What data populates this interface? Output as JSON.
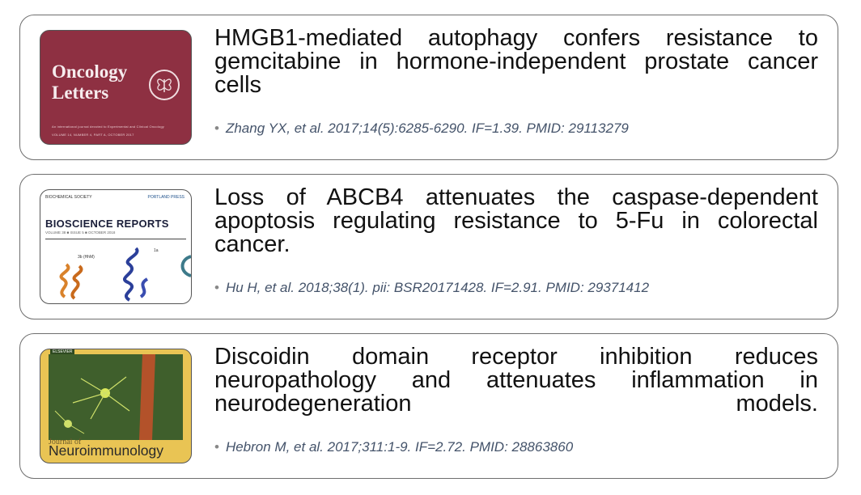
{
  "articles": [
    {
      "journal_cover": {
        "name_line1": "Oncology",
        "name_line2": "Letters",
        "fine_text": "An international journal devoted to Experimental and Clinical Oncology",
        "volume_text": "VOLUME 14, NUMBER 4, PART A, OCTOBER 2017"
      },
      "title": "HMGB1-mediated autophagy confers resistance to gemcitabine in hormone-independent prostate cancer cells",
      "citation": "Zhang YX, et al. 2017;14(5):6285-6290. IF=1.39. PMID: 29113279"
    },
    {
      "journal_cover": {
        "publisher_left": "BIOCHEMICAL SOCIETY",
        "publisher_right": "PORTLAND PRESS",
        "name": "BIOSCIENCE REPORTS",
        "volume_text": "VOLUME 38 ■ ISSUE 5 ■ OCTOBER 2018",
        "label_a": "3b (HhM)",
        "label_b": "1a"
      },
      "title": "Loss of ABCB4 attenuates the caspase-dependent apoptosis regulating resistance to 5-Fu in colorectal cancer.",
      "citation": "Hu H, et al. 2018;38(1). pii: BSR20171428. IF=2.91. PMID: 29371412"
    },
    {
      "journal_cover": {
        "corner_label": "ELSEVIER",
        "name_prefix": "Journal of",
        "name": "Neuroimmunology"
      },
      "title": "Discoidin domain receptor inhibition reduces neuropathology and attenuates inflammation in neurodegeneration models.",
      "citation": "Hebron M, et al. 2017;311:1-9. IF=2.72. PMID: 28863860"
    }
  ]
}
